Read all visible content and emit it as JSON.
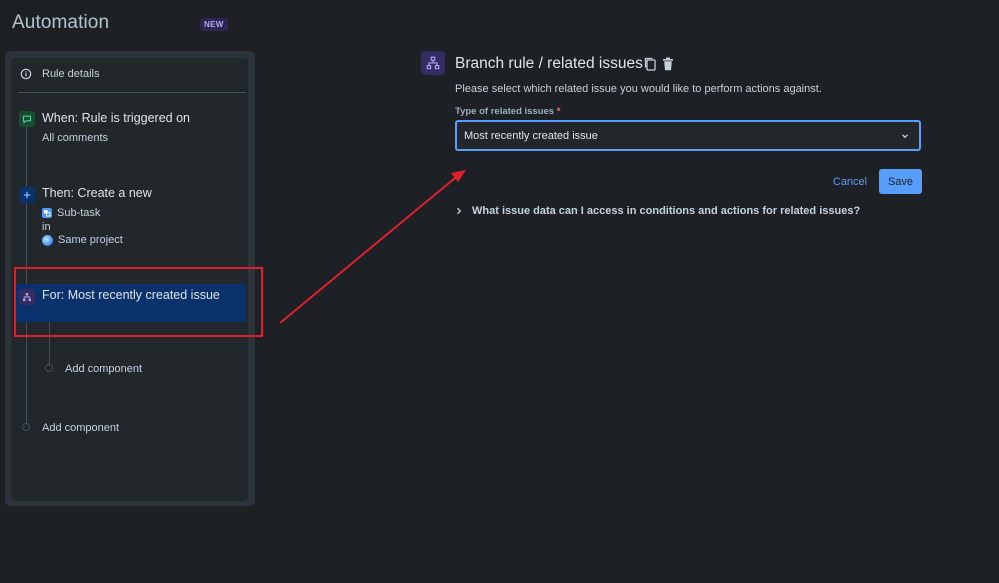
{
  "app": {
    "title": "Automation",
    "badge": "NEW"
  },
  "sidebar": {
    "rule_details": "Rule details",
    "trigger": {
      "title": "When: Rule is triggered on",
      "detail": "All comments",
      "icon": "comment-icon",
      "color": "#22a06b"
    },
    "action": {
      "title": "Then: Create a new",
      "issue_type": "Sub-task",
      "connector": "in",
      "project": "Same project",
      "icon": "plus-icon",
      "color": "#579dff"
    },
    "branch": {
      "title": "For: Most recently created issue",
      "icon": "branch-icon",
      "color": "#9f8fef"
    },
    "add_component_nested": "Add component",
    "add_component": "Add component"
  },
  "detail": {
    "heading": "Branch rule / related issues",
    "description": "Please select which related issue you would like to perform actions against.",
    "field_label": "Type of related issues",
    "required_marker": "*",
    "select_value": "Most recently created issue",
    "cancel": "Cancel",
    "save": "Save",
    "expander": "What issue data can I access in conditions and actions for related issues?"
  },
  "colors": {
    "background": "#1d2125",
    "accent": "#579dff",
    "selected": "#09326c",
    "annotation": "#e11f2b"
  }
}
